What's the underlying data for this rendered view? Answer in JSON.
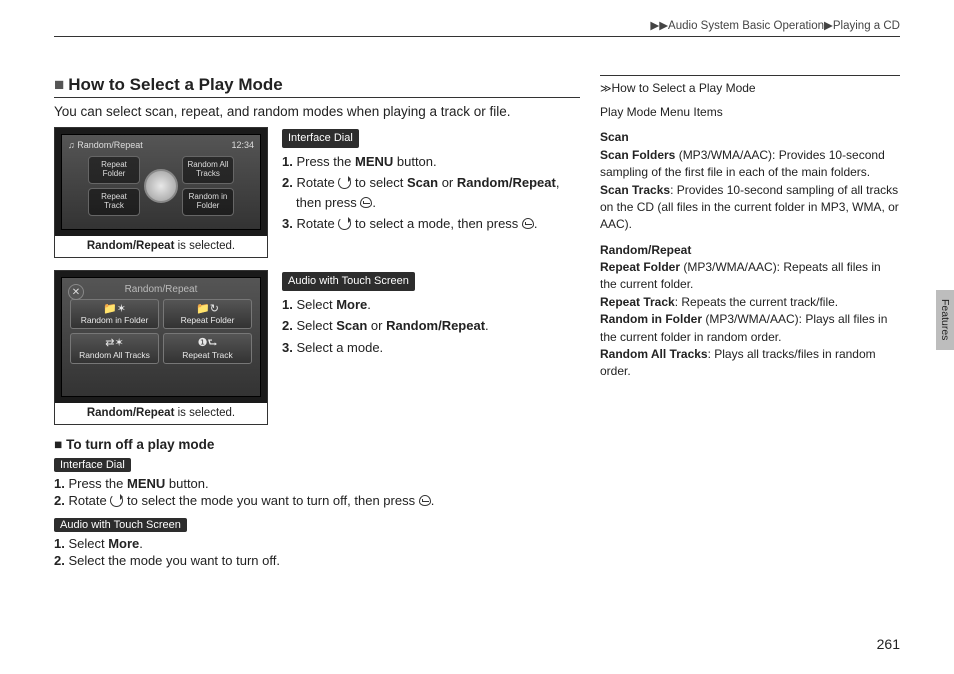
{
  "breadcrumb": {
    "arrows": "▶▶",
    "part1": "Audio System Basic Operation",
    "sep": "▶",
    "part2": "Playing a CD"
  },
  "heading": "How to Select a Play Mode",
  "intro": "You can select scan, repeat, and random modes when playing a track or file.",
  "shot1": {
    "title": "Random/Repeat",
    "time": "12:34",
    "opt_tl": "Repeat Folder",
    "opt_tr": "Random All Tracks",
    "opt_bl": "Repeat Track",
    "opt_br": "Random in Folder",
    "caption_b": "Random/Repeat",
    "caption_rest": " is selected."
  },
  "dial": {
    "pill": "Interface Dial",
    "s1a": "1.",
    "s1b": " Press the ",
    "s1c": "MENU",
    "s1d": " button.",
    "s2a": "2.",
    "s2b": " Rotate ",
    "s2c": " to select ",
    "s2d": "Scan",
    "s2e": " or ",
    "s2f": "Random/Repeat",
    "s2g": ", then press ",
    "s2h": ".",
    "s3a": "3.",
    "s3b": " Rotate ",
    "s3c": " to select a mode, then press ",
    "s3d": "."
  },
  "shot2": {
    "title": "Random/Repeat",
    "btn1": "Random in Folder",
    "btn2": "Repeat Folder",
    "btn3": "Random All Tracks",
    "btn4": "Repeat Track",
    "caption_b": "Random/Repeat",
    "caption_rest": " is selected."
  },
  "touch": {
    "pill": "Audio with Touch Screen",
    "s1a": "1.",
    "s1b": " Select ",
    "s1c": "More",
    "s1d": ".",
    "s2a": "2.",
    "s2b": " Select ",
    "s2c": "Scan",
    "s2d": " or ",
    "s2e": "Random/Repeat",
    "s2f": ".",
    "s3a": "3.",
    "s3b": " Select a mode."
  },
  "turnoff": {
    "heading": "To turn off a play mode",
    "pill1": "Interface Dial",
    "a1a": "1.",
    "a1b": " Press the ",
    "a1c": "MENU",
    "a1d": " button.",
    "a2a": "2.",
    "a2b": " Rotate ",
    "a2c": " to select the mode you want to turn off, then press ",
    "a2d": ".",
    "pill2": "Audio with Touch Screen",
    "b1a": "1.",
    "b1b": " Select ",
    "b1c": "More",
    "b1d": ".",
    "b2a": "2.",
    "b2b": " Select the mode you want to turn off."
  },
  "sidebar": {
    "title": "How to Select a Play Mode",
    "p1": "Play Mode Menu Items",
    "scan_h": "Scan",
    "scan_folders_b": "Scan Folders",
    "scan_folders": " (MP3/WMA/AAC): Provides 10-second sampling of the first file in each of the main folders.",
    "scan_tracks_b": "Scan Tracks",
    "scan_tracks": ": Provides 10-second sampling of all tracks on the CD (all files in the current folder in MP3, WMA, or AAC).",
    "rr_h": "Random/Repeat",
    "rf_b": "Repeat Folder",
    "rf": " (MP3/WMA/AAC): Repeats all files in the current folder.",
    "rt_b": "Repeat Track",
    "rt": ": Repeats the current track/file.",
    "rif_b": "Random in Folder",
    "rif": " (MP3/WMA/AAC): Plays all files in the current folder in random order.",
    "rat_b": "Random All Tracks",
    "rat": ": Plays all tracks/files in random order."
  },
  "tab_label": "Features",
  "page_number": "261"
}
